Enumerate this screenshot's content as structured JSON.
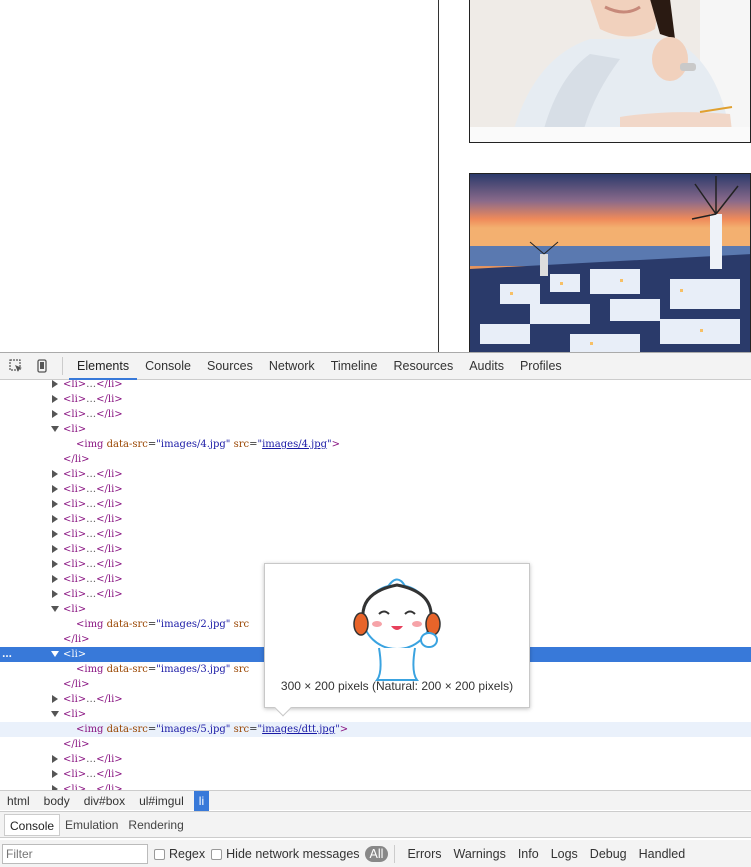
{
  "toolbar": {
    "tabs": [
      "Elements",
      "Console",
      "Sources",
      "Network",
      "Timeline",
      "Resources",
      "Audits",
      "Profiles"
    ],
    "active_tab": "Elements"
  },
  "tree": {
    "li_open": "<li>",
    "li_close": "</li>",
    "li_collapsed_ellipsis": "…",
    "img_rows": [
      {
        "data_src": "images/4.jpg",
        "src": "images/4.jpg"
      },
      {
        "data_src": "images/2.jpg",
        "src": "src"
      },
      {
        "data_src": "images/3.jpg",
        "src": "src"
      },
      {
        "data_src": "images/5.jpg",
        "src": "images/dtt.jpg"
      }
    ],
    "row_ellipsis": "…"
  },
  "tooltip": {
    "caption": "300 × 200 pixels (Natural: 200 × 200 pixels)"
  },
  "breadcrumb": [
    "html",
    "body",
    "div#box",
    "ul#imgul",
    "li"
  ],
  "drawer": {
    "tabs": [
      "Console",
      "Emulation",
      "Rendering"
    ],
    "active_tab": "Console"
  },
  "filterbar": {
    "filter_placeholder": "Filter",
    "regex_label": "Regex",
    "hide_network_label": "Hide network messages",
    "levels": [
      "All",
      "Errors",
      "Warnings",
      "Info",
      "Logs",
      "Debug",
      "Handled"
    ]
  },
  "colors": {
    "selection": "#3879d9",
    "tag": "#881280",
    "attr": "#994500",
    "value": "#1a1aa6"
  }
}
